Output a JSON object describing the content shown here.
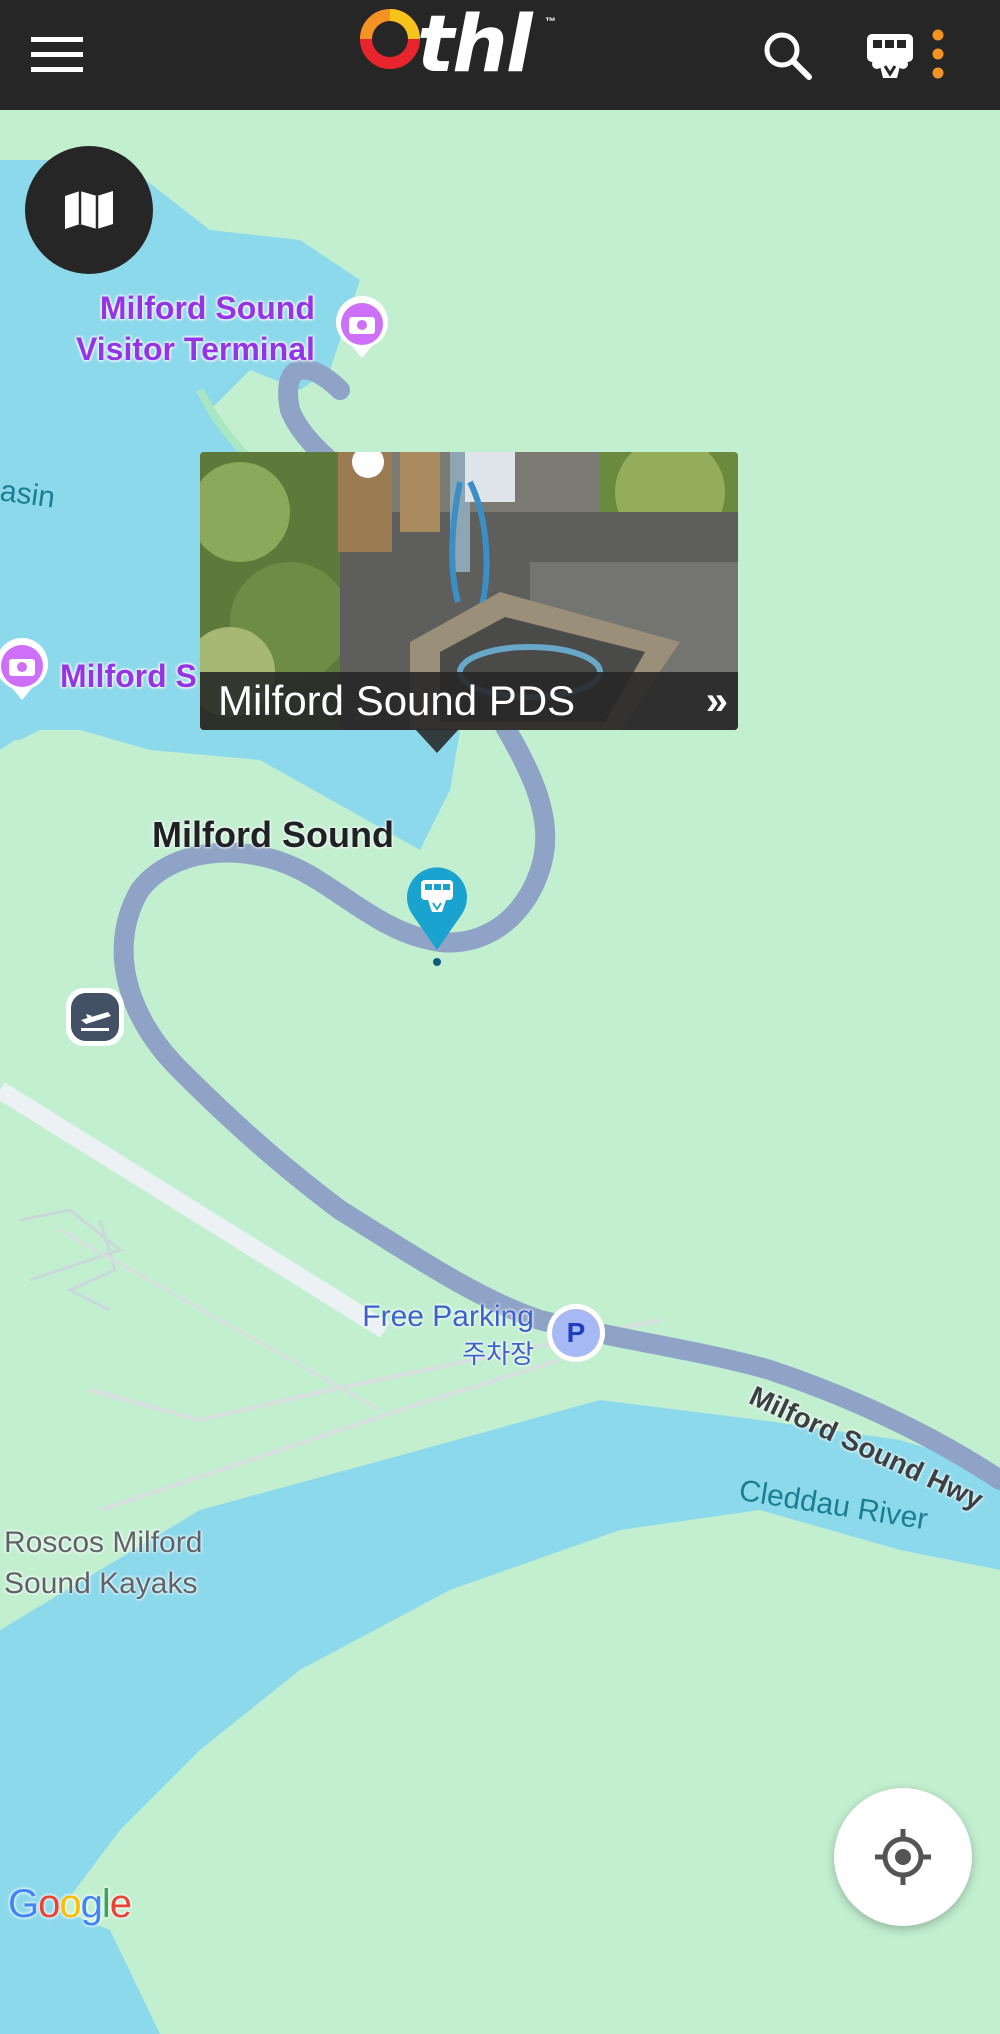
{
  "header": {
    "logo_text": "thl",
    "logo_tm": "™",
    "icons": {
      "menu": "hamburger-menu-icon",
      "search": "search-icon",
      "van": "campervan-icon",
      "more": "more-vertical-icon"
    },
    "accent_color": "#f39324"
  },
  "map": {
    "layers_icon": "map-layers-icon",
    "locate_icon": "my-location-icon",
    "labels": {
      "visitor_terminal": "Milford Sound\nVisitor Terminal",
      "basin": "asin",
      "milford_s_poi": "Milford S",
      "milford_sound_place": "Milford Sound",
      "free_parking": "Free Parking",
      "parking_korean": "주차장",
      "parking_letter": "P",
      "highway": "Milford Sound Hwy",
      "river": "Cleddau River",
      "kayaks": "Roscos Milford\nSound Kayaks"
    },
    "attribution": [
      "G",
      "o",
      "o",
      "g",
      "l",
      "e"
    ],
    "attribution_colors": [
      "#4285f4",
      "#ea4335",
      "#fbbc05",
      "#4285f4",
      "#34a853",
      "#ea4335"
    ],
    "colors": {
      "land": "#c3efd1",
      "water": "#8dd9ec",
      "road": "#8fa3c6",
      "poi": "#9334e6",
      "marker": "#1aa3cf"
    }
  },
  "popup": {
    "title": "Milford Sound PDS",
    "arrow": "»"
  }
}
